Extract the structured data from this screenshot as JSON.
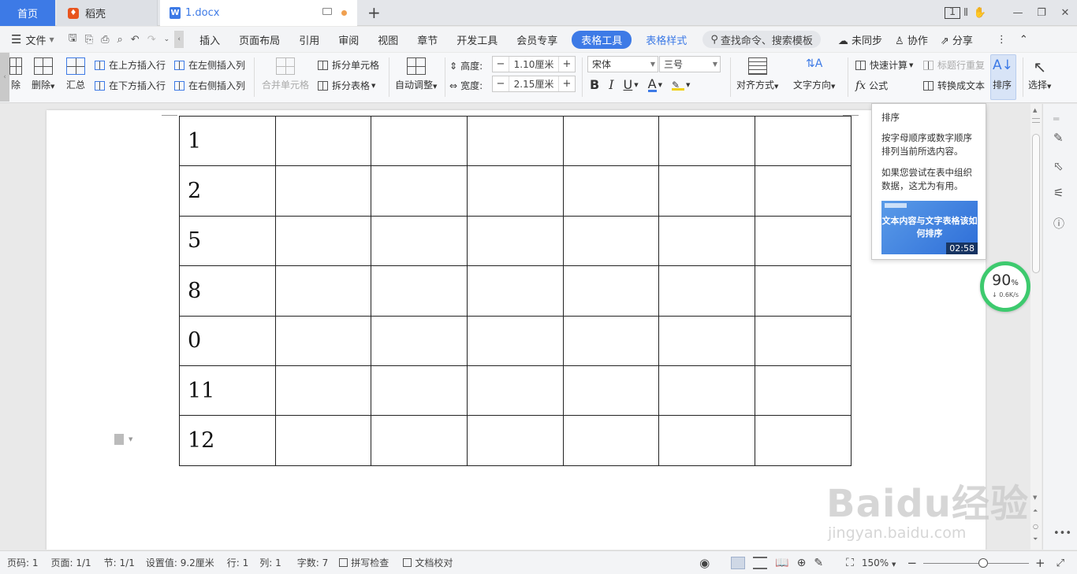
{
  "tabs": {
    "home": "首页",
    "daoke": "稻壳",
    "doc": "1.docx"
  },
  "window": {
    "badge": "1"
  },
  "menubar": {
    "file": "文件",
    "items": [
      "插入",
      "页面布局",
      "引用",
      "审阅",
      "视图",
      "章节",
      "开发工具",
      "会员专享"
    ],
    "active_pill": "表格工具",
    "table_style": "表格样式",
    "search": "查找命令、搜索模板",
    "sync": "未同步",
    "collab": "协作",
    "share": "分享"
  },
  "ribbon": {
    "delete_partial": "除",
    "delete": "删除",
    "summary": "汇总",
    "insert_above": "在上方插入行",
    "insert_below": "在下方插入行",
    "insert_left": "在左侧插入列",
    "insert_right": "在右侧插入列",
    "merge_cells": "合并单元格",
    "split_cells": "拆分单元格",
    "split_table": "拆分表格",
    "auto_fit": "自动调整",
    "height_label": "高度:",
    "height_value": "1.10厘米",
    "width_label": "宽度:",
    "width_value": "2.15厘米",
    "font": "宋体",
    "font_size": "三号",
    "bold": "B",
    "italic": "I",
    "underline": "U",
    "font_color": "A",
    "align": "对齐方式",
    "text_direction": "文字方向",
    "quick_calc": "快速计算",
    "repeat_header": "标题行重复",
    "formula": "公式",
    "to_text": "转换成文本",
    "sort": "排序",
    "select": "选择"
  },
  "tooltip": {
    "title": "排序",
    "line1": "按字母顺序或数字顺序排列当前所选内容。",
    "line2": "如果您尝试在表中组织数据，这尤为有用。",
    "video_title": "文本内容与文字表格该如何排序",
    "video_time": "02:58"
  },
  "speed": {
    "percent": "90",
    "percent_sign": "%",
    "rate": "↓ 0.6K/s"
  },
  "table": {
    "rows": [
      [
        "1",
        "",
        "",
        "",
        "",
        "",
        ""
      ],
      [
        "2",
        "",
        "",
        "",
        "",
        "",
        ""
      ],
      [
        "5",
        "",
        "",
        "",
        "",
        "",
        ""
      ],
      [
        "8",
        "",
        "",
        "",
        "",
        "",
        ""
      ],
      [
        "0",
        "",
        "",
        "",
        "",
        "",
        ""
      ],
      [
        "11",
        "",
        "",
        "",
        "",
        "",
        ""
      ],
      [
        "12",
        "",
        "",
        "",
        "",
        "",
        ""
      ]
    ]
  },
  "status": {
    "page_num": "页码: 1",
    "pages": "页面: 1/1",
    "section": "节: 1/1",
    "setting": "设置值: 9.2厘米",
    "row": "行: 1",
    "col": "列: 1",
    "words": "字数: 7",
    "spell": "拼写检查",
    "proof": "文档校对",
    "zoom": "150%"
  },
  "watermark": {
    "line1": "Baidu经验",
    "line2": "jingyan.baidu.com"
  },
  "colors": {
    "accent": "#3d7ae6",
    "progress": "#3dca6e"
  }
}
